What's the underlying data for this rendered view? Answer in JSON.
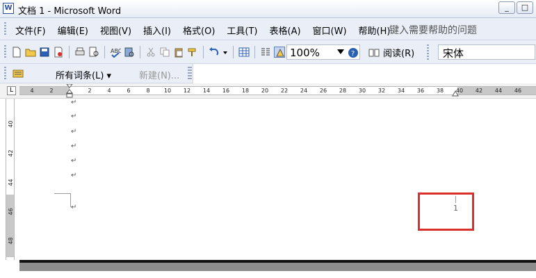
{
  "window": {
    "title": "文档 1 - Microsoft Word",
    "app_icon": "W"
  },
  "window_controls": {
    "minimize": "_",
    "restore": "□"
  },
  "menu": {
    "items": [
      "文件(F)",
      "编辑(E)",
      "视图(V)",
      "插入(I)",
      "格式(O)",
      "工具(T)",
      "表格(A)",
      "窗口(W)",
      "帮助(H)"
    ],
    "help_box": "键入需要帮助的问题"
  },
  "toolbar": {
    "zoom": "100%",
    "read_label": "阅读(R)",
    "font": "宋体"
  },
  "toolbar2": {
    "all_entries": "所有词条(L) ▾",
    "new": "新建(N)..."
  },
  "ruler": {
    "corner": "L",
    "ticks": [
      "4",
      "2",
      "2",
      "4",
      "6",
      "8",
      "10",
      "12",
      "14",
      "16",
      "18",
      "20",
      "22",
      "24",
      "26",
      "28",
      "30",
      "32",
      "34",
      "36",
      "38",
      "40",
      "42",
      "44",
      "46"
    ]
  },
  "vruler": {
    "ticks": [
      "40",
      "42",
      "44",
      "46",
      "48"
    ]
  },
  "document": {
    "paragraph_mark": "↵",
    "page_number": "1"
  },
  "colors": {
    "highlight_border": "#d9302b",
    "chrome": "#e9eef7"
  }
}
